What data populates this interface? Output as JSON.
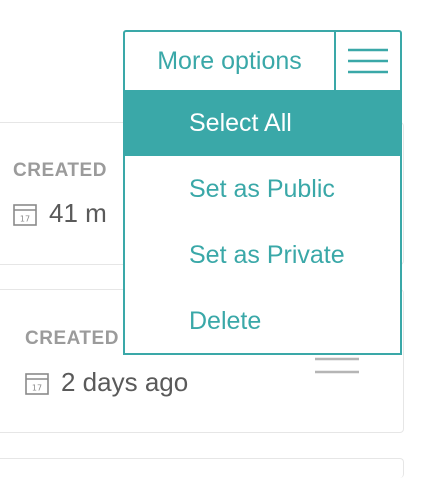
{
  "cards": [
    {
      "created_label": "CREATED",
      "date_text": "41 m"
    },
    {
      "created_label": "CREATED",
      "date_text": "2 days ago"
    }
  ],
  "icons": {
    "calendar_day": "17"
  },
  "dropdown": {
    "title": "More options",
    "items": [
      {
        "label": "Select All",
        "active": true
      },
      {
        "label": "Set as Public"
      },
      {
        "label": "Set as Private"
      },
      {
        "label": "Delete"
      }
    ]
  },
  "colors": {
    "accent": "#3aa8a8",
    "muted_text": "#9b9b9b",
    "body_text": "#5a5a5a",
    "card_border": "#e6e6e6"
  }
}
